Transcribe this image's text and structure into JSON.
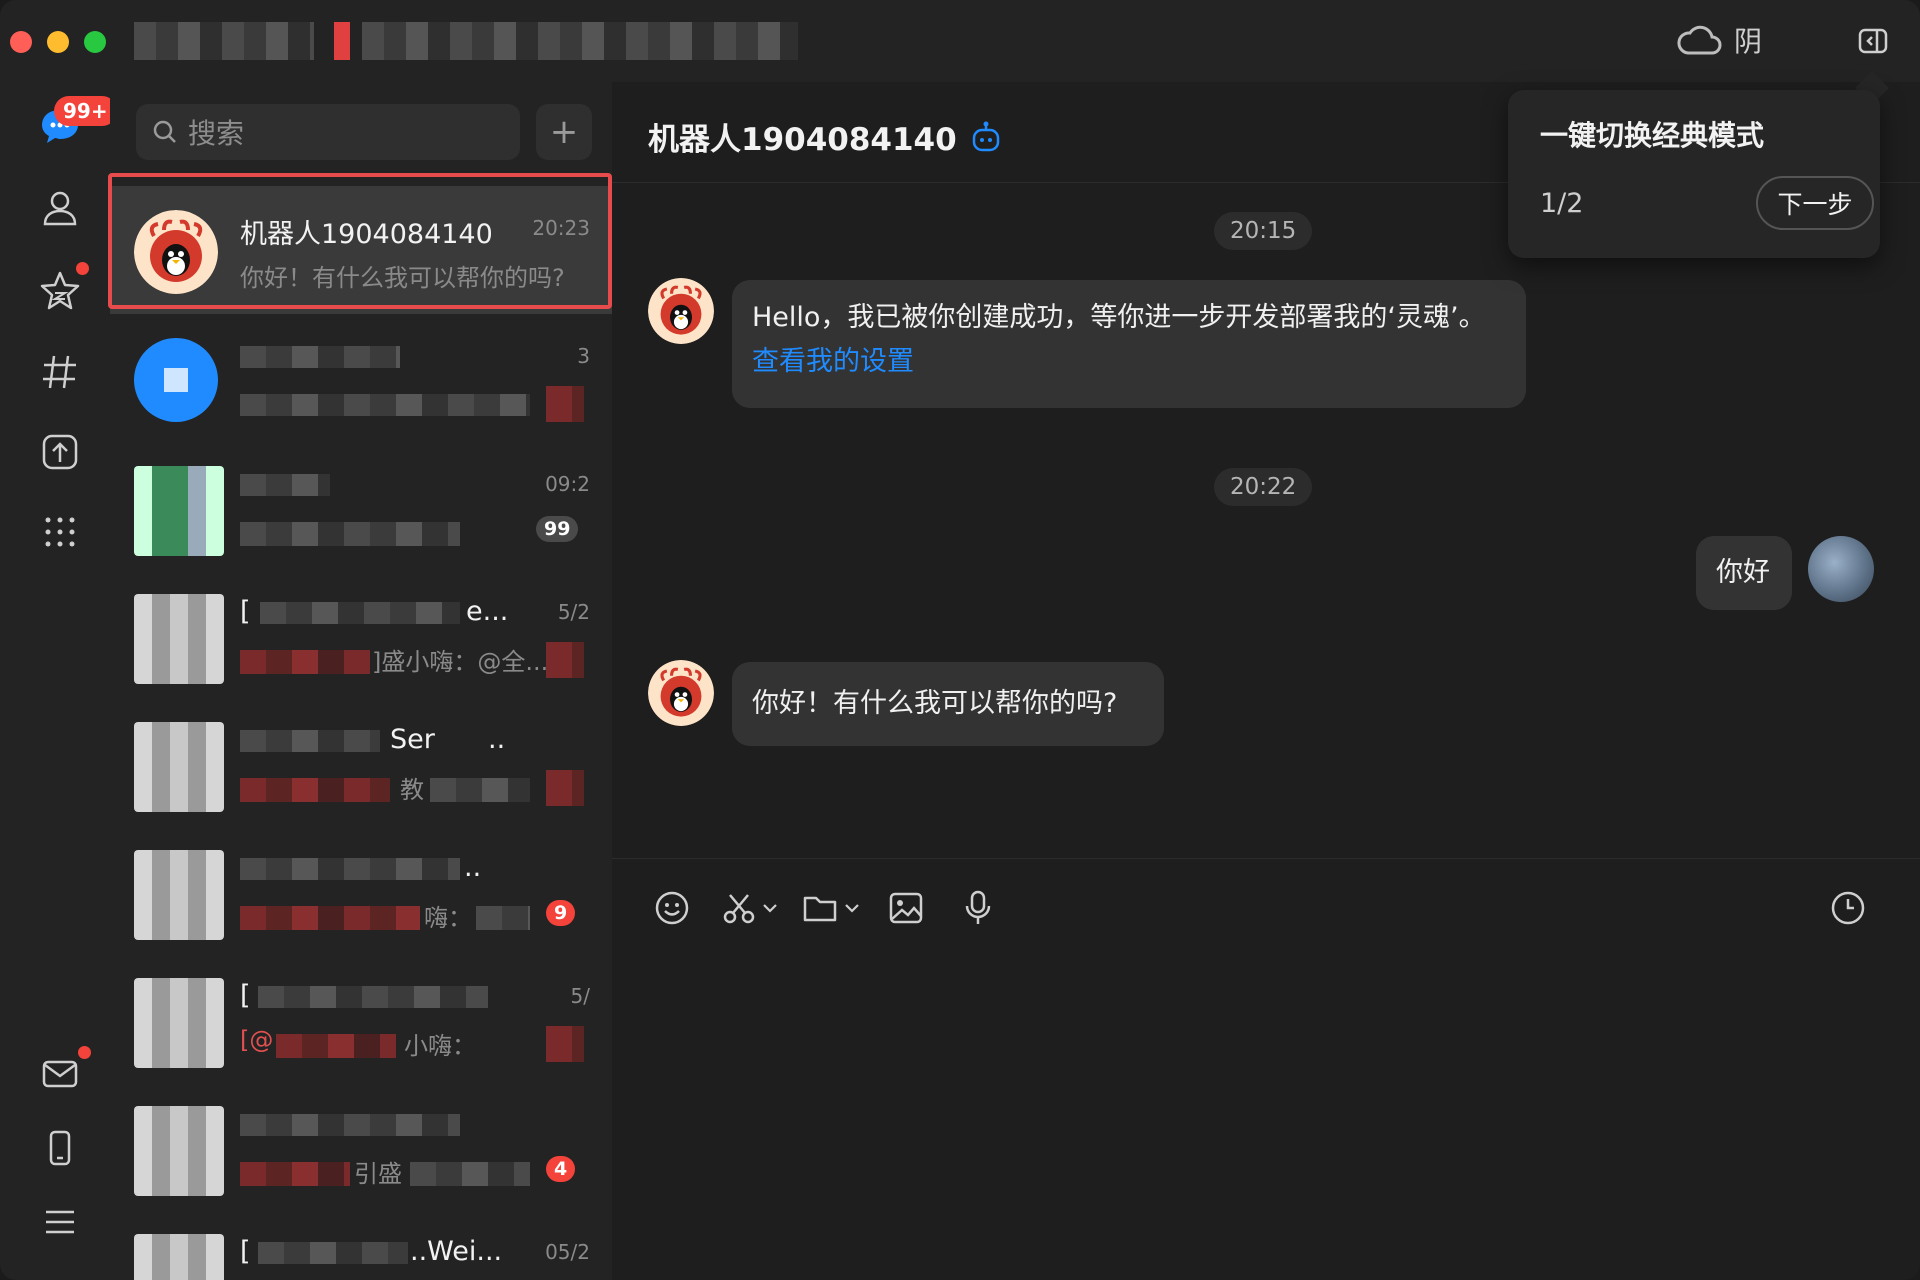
{
  "window": {
    "weather_text": "阴"
  },
  "nav": {
    "unread_badge": "99+",
    "icons": [
      "chat-icon",
      "contacts-icon",
      "favorites-icon",
      "channels-icon",
      "upload-icon",
      "apps-icon",
      "mail-icon",
      "phone-icon",
      "menu-icon"
    ]
  },
  "chatlist": {
    "search_placeholder": "搜索",
    "add_label": "+",
    "items": [
      {
        "name": "机器人1904084140",
        "time": "20:23",
        "preview": "你好！有什么我可以帮你的吗?",
        "selected": true
      },
      {
        "name": "",
        "time": "3",
        "preview": ""
      },
      {
        "name": "",
        "time": "09:2",
        "preview": "",
        "badge": "99"
      },
      {
        "name": "[",
        "title_tail": "e...",
        "time": "5/2",
        "preview_tail": "]盛小嗨：@全..."
      },
      {
        "name": "Ser",
        "title_tail": "..",
        "time": "",
        "preview_tail": "教"
      },
      {
        "name": "",
        "title_tail": "..",
        "time": "",
        "preview_tail": "嗨：",
        "badge": "9"
      },
      {
        "name": "[",
        "time": "5/",
        "preview_head": "[@",
        "preview_tail": "小嗨："
      },
      {
        "name": "",
        "time": "",
        "preview_tail": "引盛",
        "badge": "4"
      },
      {
        "name": "[",
        "title_tail": "..Wei...",
        "time": "05/2"
      }
    ]
  },
  "conversation": {
    "title": "机器人1904084140",
    "messages": [
      {
        "type": "time",
        "text": "20:15"
      },
      {
        "type": "incoming",
        "text": "Hello，我已被你创建成功，等你进一步开发部署我的‘灵魂’。",
        "link": "查看我的设置"
      },
      {
        "type": "time",
        "text": "20:22"
      },
      {
        "type": "outgoing",
        "text": "你好"
      },
      {
        "type": "incoming",
        "text": "你好！有什么我可以帮你的吗?"
      }
    ],
    "toolbar": [
      "emoji-icon",
      "screenshot-icon",
      "folder-icon",
      "image-icon",
      "microphone-icon",
      "history-icon"
    ]
  },
  "popover": {
    "title": "一键切换经典模式",
    "step": "1/2",
    "next_label": "下一步"
  },
  "colors": {
    "accent_blue": "#1f8bff",
    "badge_red": "#f4433a",
    "selection_border": "#e84b4b",
    "bubble_bg": "#333333"
  }
}
